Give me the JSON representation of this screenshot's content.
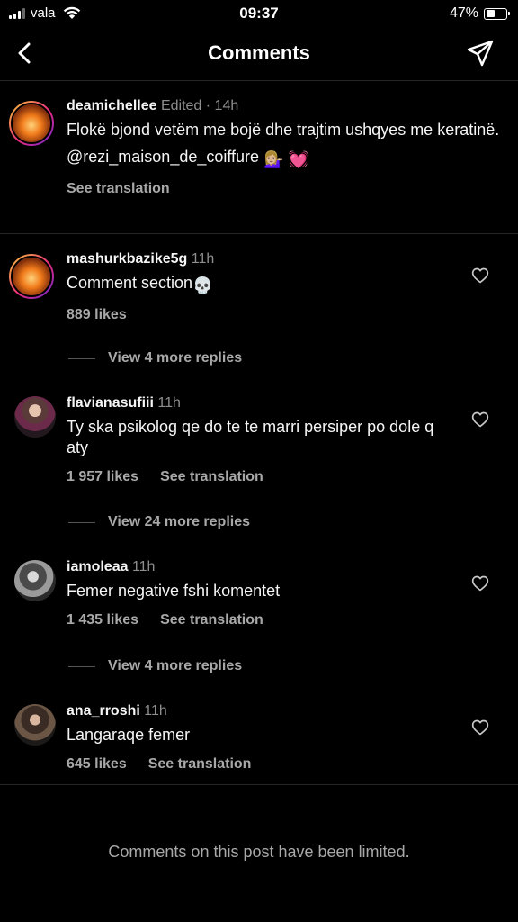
{
  "status": {
    "carrier": "vala",
    "time": "09:37",
    "battery": "47%",
    "battery_level": 0.47
  },
  "header": {
    "title": "Comments",
    "back_icon": "chevron-left-icon",
    "send_icon": "paper-plane-icon"
  },
  "caption": {
    "username": "deamichellee",
    "meta": "Edited · 14h",
    "text": "Flokë bjond vetëm me bojë dhe trajtim ushqyes me keratinë.",
    "mention": "@rezi_maison_de_coiffure",
    "emojis": "💁🏼‍♀️ 💓",
    "see_translation": "See translation"
  },
  "comments": [
    {
      "username": "mashurkbazike5g",
      "time": "11h",
      "text": "Comment section",
      "emoji": "💀",
      "likes": "889 likes",
      "see_translation": "",
      "replies": "View 4 more replies"
    },
    {
      "username": "flavianasufiii",
      "time": "11h",
      "text": "Ty ska psikolog qe do te te marri persiper po dole q aty",
      "likes": "1 957 likes",
      "see_translation": "See translation",
      "replies": "View 24 more replies"
    },
    {
      "username": "iamoleaa",
      "time": "11h",
      "text": "Femer negative fshi komentet",
      "likes": "1 435 likes",
      "see_translation": "See translation",
      "replies": "View 4 more replies"
    },
    {
      "username": "ana_rroshi",
      "time": "11h",
      "text": "Langaraqe femer",
      "likes": "645 likes",
      "see_translation": "See translation"
    }
  ],
  "footer": {
    "limited": "Comments on this post have been limited."
  }
}
